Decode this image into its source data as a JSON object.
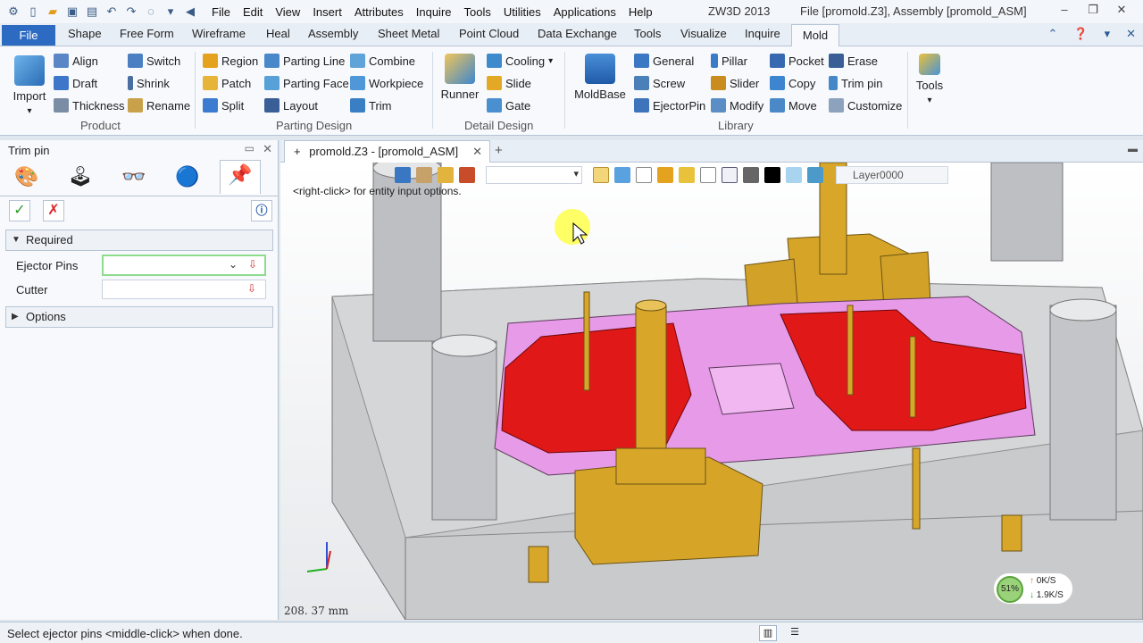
{
  "window": {
    "app_title": "ZW3D 2013",
    "file_title": "File [promold.Z3],  Assembly [promold_ASM]"
  },
  "menu": [
    "File",
    "Edit",
    "View",
    "Insert",
    "Attributes",
    "Inquire",
    "Tools",
    "Utilities",
    "Applications",
    "Help"
  ],
  "ribbon_tabs": [
    "File",
    "Shape",
    "Free Form",
    "Wireframe",
    "Heal",
    "Assembly",
    "Sheet Metal",
    "Point Cloud",
    "Data Exchange",
    "Tools",
    "Visualize",
    "Inquire",
    "Mold"
  ],
  "active_tab": "Mold",
  "ribbon": {
    "product": {
      "group": "Product",
      "import": "Import",
      "align": "Align",
      "draft": "Draft",
      "thickness": "Thickness",
      "switch": "Switch",
      "shrink": "Shrink",
      "rename": "Rename"
    },
    "parting": {
      "group": "Parting Design",
      "region": "Region",
      "patch": "Patch",
      "split": "Split",
      "parting_line": "Parting Line",
      "parting_face": "Parting Face",
      "layout": "Layout",
      "combine": "Combine",
      "workpiece": "Workpiece",
      "trim": "Trim"
    },
    "detail": {
      "group": "Detail Design",
      "runner": "Runner",
      "cooling": "Cooling",
      "slide": "Slide",
      "gate": "Gate"
    },
    "library": {
      "group": "Library",
      "moldbase": "MoldBase",
      "general": "General",
      "screw": "Screw",
      "ejectorpin": "EjectorPin",
      "pillar": "Pillar",
      "slider": "Slider",
      "modify": "Modify",
      "pocket": "Pocket",
      "copy": "Copy",
      "move": "Move",
      "erase": "Erase",
      "trim_pin": "Trim pin",
      "customize": "Customize"
    },
    "tools": "Tools"
  },
  "panel": {
    "title": "Trim pin",
    "required": "Required",
    "ejector_pins_label": "Ejector Pins",
    "cutter_label": "Cutter",
    "options": "Options"
  },
  "document_tab": "promold.Z3 - [promold_ASM]",
  "viewport": {
    "hint": "<right-click> for entity input options.",
    "layer": "Layer0000",
    "scale": "208. 37  mm",
    "cpu": "51%",
    "upload": "0K/S",
    "download": "1.9K/S"
  },
  "status": {
    "message": "Select ejector pins  <middle-click> when done."
  },
  "colors": {
    "accent": "#2d6bc2",
    "mold_pink": "#e79ae8",
    "cavity_red": "#e01818",
    "pin_gold": "#d6a528",
    "plate_gray": "#c9cacc"
  }
}
